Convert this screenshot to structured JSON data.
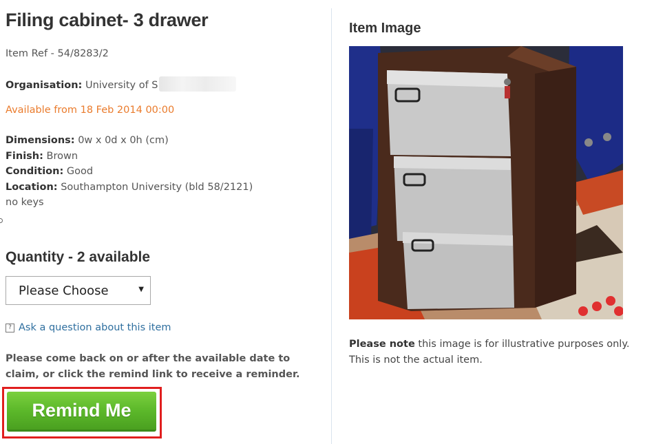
{
  "item": {
    "title": "Filing cabinet- 3 drawer",
    "ref": "Item Ref - 54/8283/2",
    "organisation_label": "Organisation:",
    "organisation_value": "University of S",
    "availability": "Available from 18 Feb 2014 00:00",
    "details": [
      {
        "label": "Dimensions:",
        "value": "0w x 0d x 0h (cm)"
      },
      {
        "label": "Finish:",
        "value": "Brown"
      },
      {
        "label": "Condition:",
        "value": "Good"
      },
      {
        "label": "Location:",
        "value": "Southampton University (bld 58/2121)"
      }
    ],
    "extra_note": "no keys"
  },
  "quantity": {
    "heading": "Quantity - 2 available",
    "select_value": "Please Choose"
  },
  "ask_link": "Ask a question about this item",
  "claim_text": "Please come back on or after the available date to claim, or click the remind link to receive a reminder.",
  "remind_button": "Remind Me",
  "image_panel": {
    "heading": "Item Image",
    "note_bold": "Please note",
    "note_text": " this image is for illustrative purposes only. This is not the actual item."
  },
  "icons": {
    "ask_icon": "question-icon",
    "select_icon": "dropdown-caret-icon"
  },
  "colors": {
    "availability": "#ea7b2c",
    "link": "#2f6f9f",
    "button_green": "#5cb82a",
    "highlight_red": "#e01e1e"
  }
}
